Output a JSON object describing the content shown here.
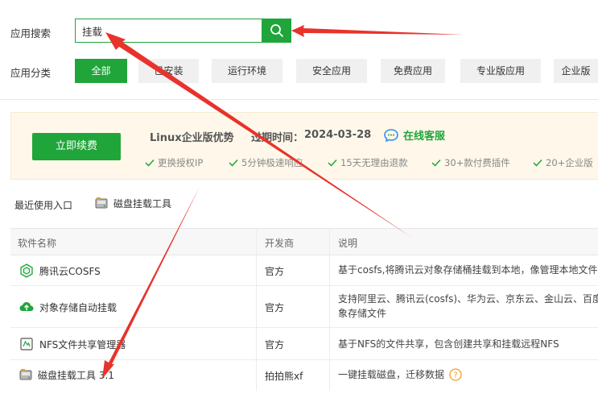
{
  "search": {
    "label": "应用搜索",
    "value": "挂载"
  },
  "categories": {
    "label": "应用分类",
    "items": [
      {
        "label": "全部",
        "active": true
      },
      {
        "label": "已安装",
        "active": false
      },
      {
        "label": "运行环境",
        "active": false
      },
      {
        "label": "安全应用",
        "active": false
      },
      {
        "label": "免费应用",
        "active": false
      },
      {
        "label": "专业版应用",
        "active": false
      },
      {
        "label": "企业版",
        "active": false
      }
    ]
  },
  "promo": {
    "renew_label": "立即续费",
    "title": "Linux企业版优势",
    "expire_label": "过期时间：",
    "expire_date": "2024-03-28",
    "service_label": "在线客服",
    "features": [
      "更换授权IP",
      "5分钟极速响应",
      "15天无理由退款",
      "30+款付费插件",
      "20+企业版"
    ]
  },
  "recent": {
    "label": "最近使用入口",
    "items": [
      "磁盘挂载工具"
    ]
  },
  "table": {
    "headers": {
      "name": "软件名称",
      "developer": "开发商",
      "description": "说明"
    },
    "rows": [
      {
        "name": "腾讯云COSFS",
        "developer": "官方",
        "desc1": "基于cosfs,将腾讯云对象存储桶挂载到本地，像管理本地文件",
        "desc2": ""
      },
      {
        "name": "对象存储自动挂载",
        "developer": "官方",
        "desc1": "支持阿里云、腾讯云(cosfs)、华为云、京东云、金山云、百度",
        "desc2": "象存储文件"
      },
      {
        "name": "NFS文件共享管理器",
        "developer": "官方",
        "desc1": "基于NFS的文件共享，包含创建共享和挂载远程NFS",
        "desc2": ""
      },
      {
        "name": "磁盘挂载工具 3.1",
        "developer": "拍拍熊xf",
        "desc1": "一键挂载磁盘，迁移数据",
        "desc2": ""
      }
    ]
  },
  "colors": {
    "accent": "#20a53a",
    "arrow": "#e8322c",
    "help": "#f0a020"
  }
}
